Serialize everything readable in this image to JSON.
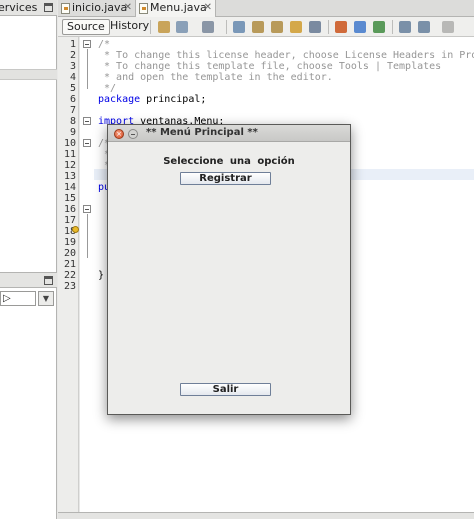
{
  "left_panel": {
    "tab_label": "ervices",
    "combo_value": "▷",
    "combo_arrow": "▼"
  },
  "editor": {
    "tabs": [
      {
        "label": "inicio.java",
        "close": "✕"
      },
      {
        "label": "Menu.java",
        "close": "✕"
      }
    ],
    "toolbar": {
      "source_label": "Source",
      "history_label": "History"
    },
    "line_numbers": [
      "1",
      "2",
      "3",
      "4",
      "5",
      "6",
      "7",
      "8",
      "9",
      "10",
      "11",
      "12",
      "13",
      "14",
      "15",
      "16",
      "17",
      "18",
      "19",
      "20",
      "21",
      "22",
      "23"
    ],
    "code": {
      "l1": "/*",
      "l2": " * To change this license header, choose License Headers in Project P",
      "l3": " * To change this template file, choose Tools | Templates",
      "l4": " * and open the template in the editor.",
      "l5": " */",
      "l6_kw": "package",
      "l6_rest": " principal;",
      "l8_kw": "import",
      "l8_rest": " ventanas.Menu;",
      "l10": "/*",
      "l11": " *",
      "l12": " *",
      "l14": "pu",
      "l22": "}"
    }
  },
  "dialog": {
    "title": "** Menú Principal **",
    "close_glyph": "×",
    "prompt": "Seleccione una opción",
    "register_label": "Registrar",
    "exit_label": "Salir"
  },
  "colors": {
    "keyword": "#0000e6",
    "comment": "#969696",
    "button_border": "#6f7f98"
  }
}
